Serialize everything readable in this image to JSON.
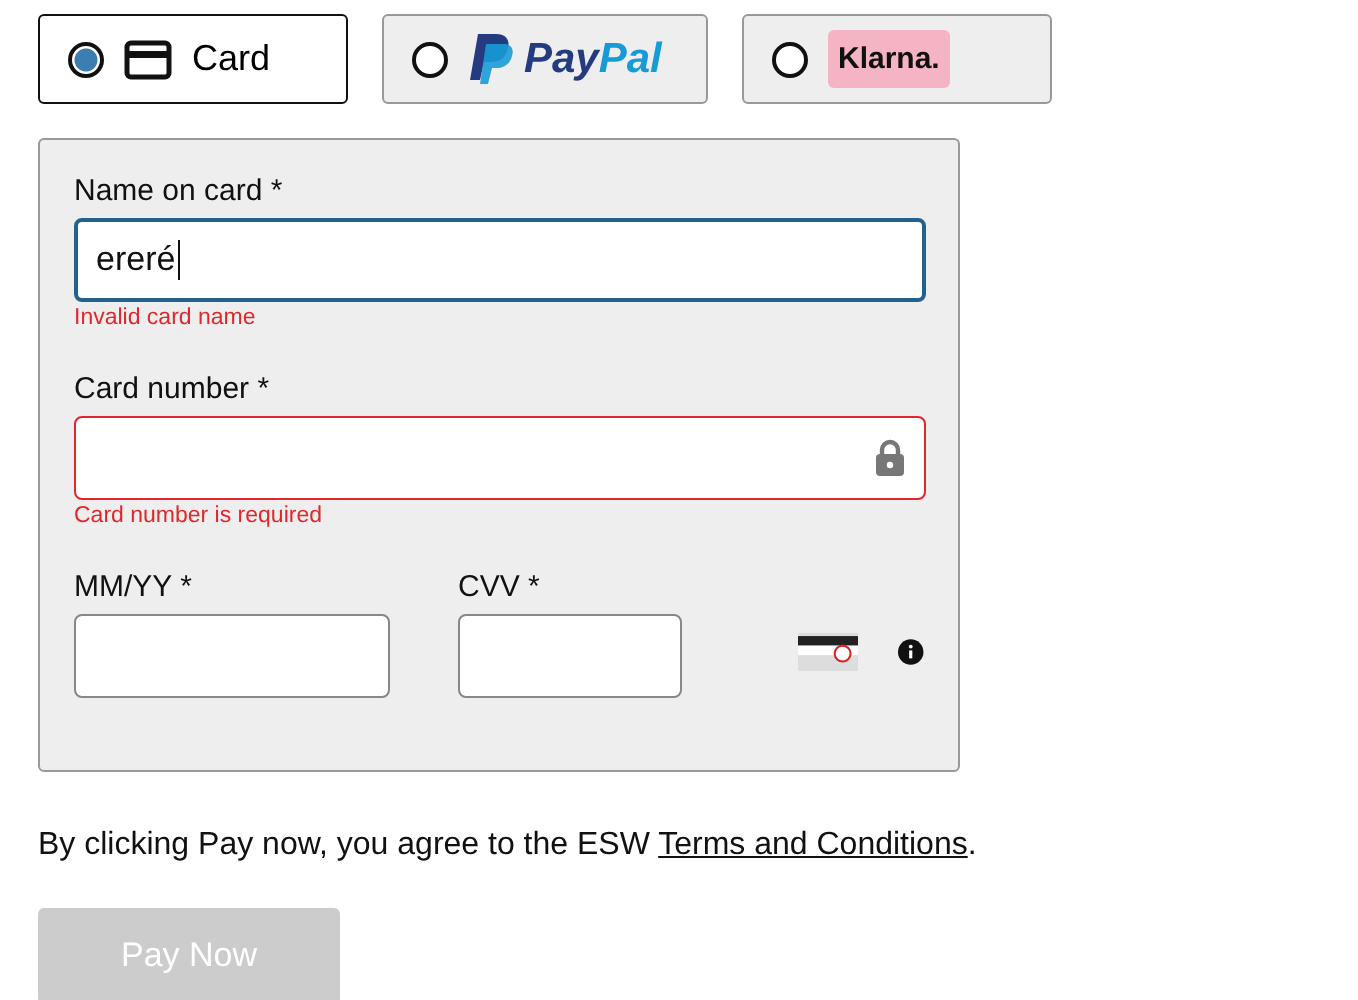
{
  "payment_methods": [
    {
      "kind": "card",
      "label": "Card",
      "selected": true
    },
    {
      "kind": "paypal",
      "label": "PayPal",
      "selected": false
    },
    {
      "kind": "klarna",
      "label": "Klarna.",
      "selected": false
    }
  ],
  "card_form": {
    "fields": [
      {
        "kind": "name",
        "label": "Name on card *",
        "value": "ereré",
        "focused": true,
        "error": true,
        "message": "Invalid card name"
      },
      {
        "kind": "number",
        "label": "Card number *",
        "focused": false,
        "error": true,
        "message": "Card number is required"
      }
    ],
    "expiry": {
      "label": "MM/YY *",
      "error": false
    },
    "cvv": {
      "label": "CVV *",
      "error": false
    }
  },
  "agreement": {
    "text": "By clicking Pay now, you agree to the ESW ",
    "link": "Terms and Conditions",
    "end": "."
  },
  "pay_button": {
    "label": "Pay Now",
    "disabled": true
  }
}
